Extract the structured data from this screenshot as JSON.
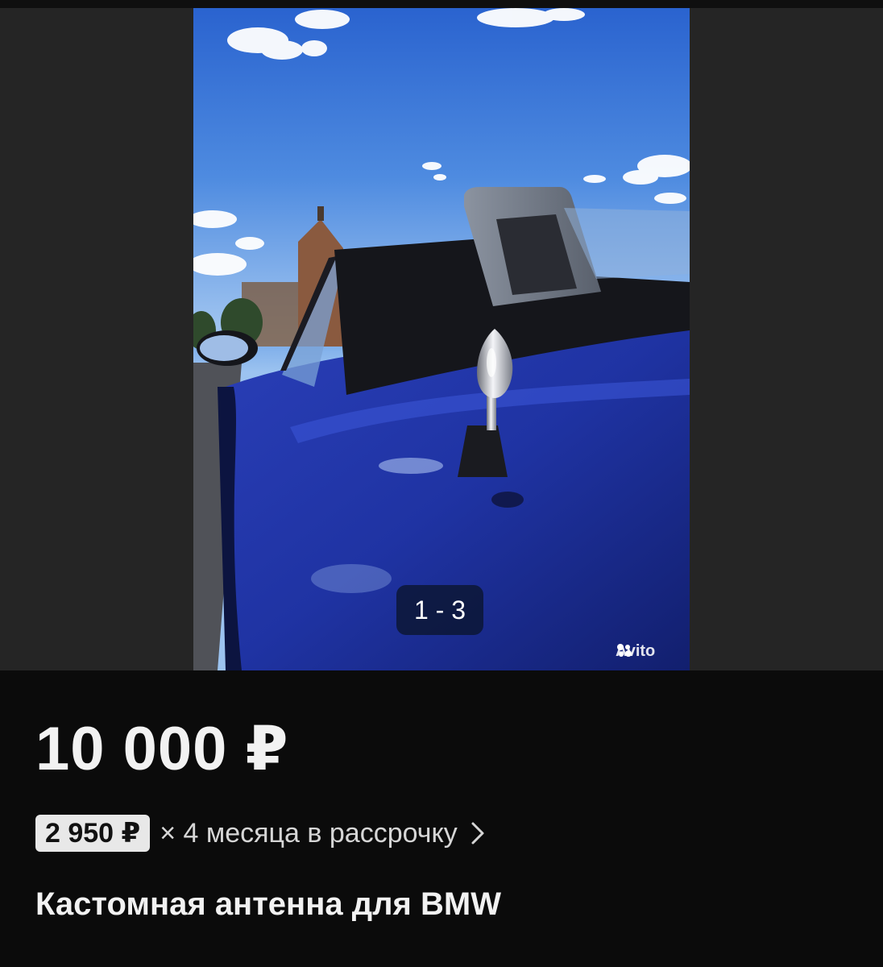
{
  "gallery": {
    "counter": "1 - 3",
    "watermark": "Avito",
    "image_alt": "Blue BMW convertible with custom chrome antenna"
  },
  "listing": {
    "price": "10 000 ₽",
    "installment": {
      "amount": "2 950 ₽",
      "text": "× 4 месяца в рассрочку"
    },
    "title": "Кастомная антенна для BMW"
  },
  "colors": {
    "background": "#0b0b0b",
    "gallery_bg": "#252525",
    "text": "#f2f2f2",
    "badge_bg": "#e8e8e8"
  },
  "icons": {
    "installment_chevron": "chevron-right-icon",
    "watermark_logo": "avito-logo-icon"
  }
}
